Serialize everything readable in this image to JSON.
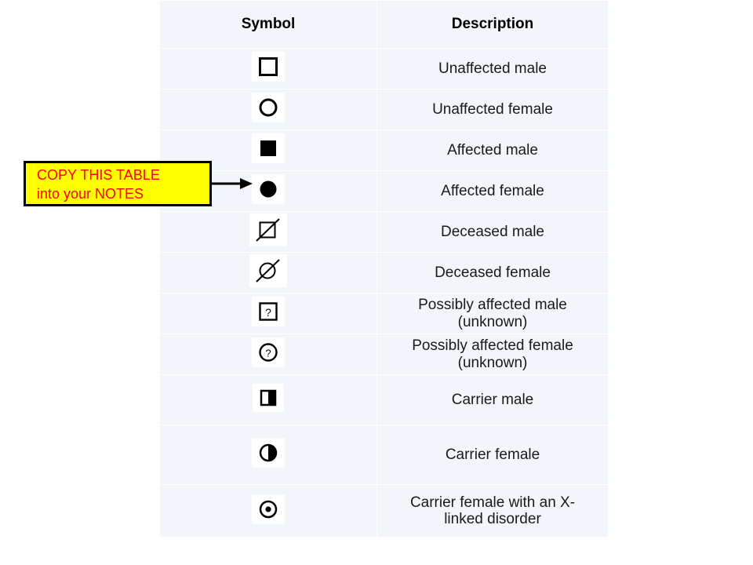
{
  "callout": {
    "line1": "COPY THIS TABLE",
    "line2": "into your NOTES",
    "background_color": "#ffff00",
    "border_color": "#000000",
    "text_color": "#ff0000",
    "arrow_icon": "arrow-right-icon"
  },
  "table": {
    "background_color": "#f2f6fa",
    "gridline_color": "#ffffff",
    "headers": {
      "symbol": "Symbol",
      "description": "Description"
    },
    "rows": [
      {
        "icon": "unaffected-male-square-icon",
        "description": "Unaffected male",
        "description_sub": ""
      },
      {
        "icon": "unaffected-female-circle-icon",
        "description": "Unaffected female",
        "description_sub": ""
      },
      {
        "icon": "affected-male-filled-square-icon",
        "description": "Affected male",
        "description_sub": ""
      },
      {
        "icon": "affected-female-filled-circle-icon",
        "description": "Affected female",
        "description_sub": ""
      },
      {
        "icon": "deceased-male-slashed-square-icon",
        "description": "Deceased male",
        "description_sub": ""
      },
      {
        "icon": "deceased-female-slashed-circle-icon",
        "description": "Deceased female",
        "description_sub": ""
      },
      {
        "icon": "possibly-affected-male-question-square-icon",
        "description": "Possibly affected male",
        "description_sub": "(unknown)"
      },
      {
        "icon": "possibly-affected-female-question-circle-icon",
        "description": "Possibly affected female",
        "description_sub": "(unknown)"
      },
      {
        "icon": "carrier-male-half-filled-square-icon",
        "description": "Carrier  male",
        "description_sub": ""
      },
      {
        "icon": "carrier-female-half-filled-circle-icon",
        "description": "Carrier  female",
        "description_sub": ""
      },
      {
        "icon": "carrier-female-x-linked-dot-circle-icon",
        "description": "Carrier female with an X-",
        "description_sub": "linked disorder"
      }
    ]
  }
}
